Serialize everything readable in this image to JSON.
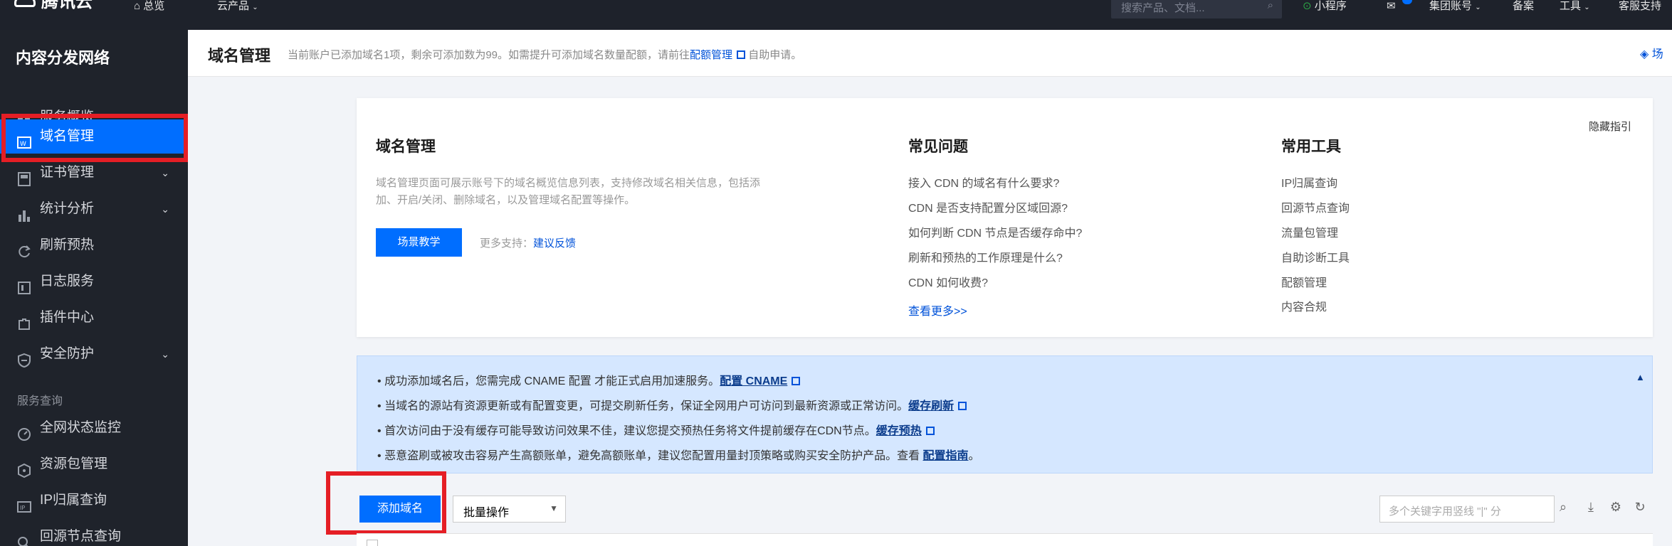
{
  "topbar": {
    "brand": "腾讯云",
    "overview": "总览",
    "products": "云产品",
    "search_placeholder": "搜索产品、文档...",
    "mini_program": "小程序",
    "group_account": "集团账号",
    "filing": "备案",
    "tools": "工具",
    "support": "客服支持"
  },
  "sidebar": {
    "title": "内容分发网络",
    "items": [
      {
        "label": "服务概览",
        "icon": "grid-icon"
      },
      {
        "label": "域名管理",
        "icon": "domain-icon",
        "active": true
      },
      {
        "label": "证书管理",
        "icon": "certificate-icon",
        "expandable": true
      },
      {
        "label": "统计分析",
        "icon": "chart-icon",
        "expandable": true
      },
      {
        "label": "刷新预热",
        "icon": "refresh-icon"
      },
      {
        "label": "日志服务",
        "icon": "log-icon"
      },
      {
        "label": "插件中心",
        "icon": "plugin-icon"
      },
      {
        "label": "安全防护",
        "icon": "shield-icon",
        "expandable": true
      }
    ],
    "section_label": "服务查询",
    "query_items": [
      {
        "label": "全网状态监控",
        "icon": "monitor-icon"
      },
      {
        "label": "资源包管理",
        "icon": "package-icon"
      },
      {
        "label": "IP归属查询",
        "icon": "ip-icon"
      },
      {
        "label": "回源节点查询",
        "icon": "search-node-icon"
      }
    ]
  },
  "header": {
    "title": "域名管理",
    "notice": "当前账户已添加域名1项，剩余可添加数为99。如需提升可添加域名数量配额，请前往",
    "quota_link": "配额管理",
    "notice_suffix": "自助申请。",
    "right_link": "场"
  },
  "guide": {
    "title": "域名管理",
    "description": "域名管理页面可展示账号下的域名概览信息列表，支持修改域名相关信息，包括添加、开启/关闭、删除域名，以及管理域名配置等操作。",
    "tutorial_button": "场景教学",
    "more_support": "更多支持：",
    "feedback_link": "建议反馈",
    "hide_guide": "隐藏指引",
    "faq_title": "常见问题",
    "faq": [
      "接入 CDN 的域名有什么要求?",
      "CDN 是否支持配置分区域回源?",
      "如何判断 CDN 节点是否缓存命中?",
      "刷新和预热的工作原理是什么?",
      "CDN 如何收费?"
    ],
    "faq_more": "查看更多>>",
    "tools_title": "常用工具",
    "tools": [
      "IP归属查询",
      "回源节点查询",
      "流量包管理",
      "自助诊断工具",
      "配额管理",
      "内容合规"
    ]
  },
  "info": {
    "lines": [
      {
        "text": "成功添加域名后，您需完成 CNAME 配置 才能正式启用加速服务。",
        "link": "配置 CNAME"
      },
      {
        "text": "当域名的源站有资源更新或有配置变更，可提交刷新任务，保证全网用户可访问到最新资源或正常访问。",
        "link": "缓存刷新"
      },
      {
        "text": "首次访问由于没有缓存可能导致访问效果不佳，建议您提交预热任务将文件提前缓存在CDN节点。",
        "link": "缓存预热"
      },
      {
        "text": "恶意盗刷或被攻击容易产生高额账单，避免高额账单，建议您配置用量封顶策略或购买安全防护产品。查看 ",
        "link": "配置指南",
        "suffix": "。"
      }
    ]
  },
  "toolbar": {
    "add_domain": "添加域名",
    "batch_ops": "批量操作",
    "filter_placeholder": "多个关键字用竖线 \"|\" 分"
  },
  "colors": {
    "accent": "#006eff",
    "sidebar_bg": "#1f232b",
    "highlight_red": "#e51e25"
  }
}
